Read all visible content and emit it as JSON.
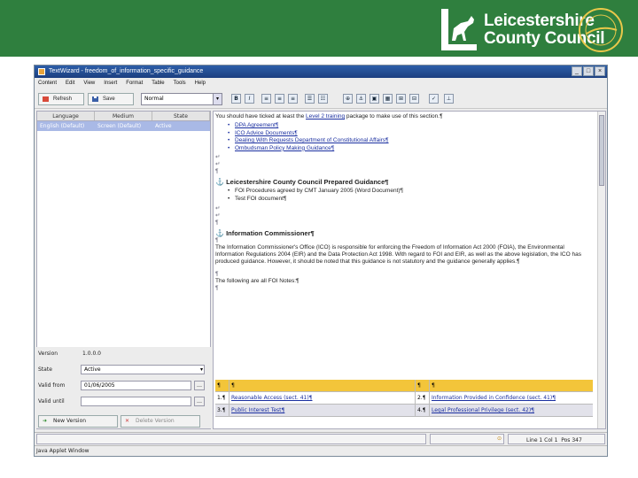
{
  "banner": {
    "council_line1": "Leicestershire",
    "council_line2": "County Council",
    "seal_text": "RATED AN Excellent COUNCIL",
    "color": "#2f7f3e"
  },
  "window": {
    "title": "TextWizard - freedom_of_information_specific_guidance",
    "menu": [
      "Content",
      "Edit",
      "View",
      "Insert",
      "Format",
      "Table",
      "Tools",
      "Help"
    ]
  },
  "toolbar": {
    "refresh_label": "Refresh",
    "save_label": "Save",
    "style_value": "Normal"
  },
  "languages": {
    "columns": [
      "Language",
      "Medium",
      "State"
    ],
    "rows": [
      [
        "English (Default)",
        "Screen (Default)",
        "Active"
      ]
    ]
  },
  "properties": {
    "version_label": "Version",
    "version_value": "1.0.0.0",
    "state_label": "State",
    "state_value": "Active",
    "valid_from_label": "Valid from",
    "valid_from_value": "01/06/2005",
    "valid_until_label": "Valid until",
    "valid_until_value": "",
    "new_version_label": "New Version",
    "delete_version_label": "Delete Version"
  },
  "document": {
    "intro": "You should have ticked at least the Level 2 training package to make use of this section.¶",
    "intro_link": "Level 2 training",
    "bullets1": [
      "DPA Agreement¶",
      "ICO Advice Documents¶",
      "Dealing With Requests Department of Constitutional Affairs¶",
      "Ombudsman Policy Making Guidance¶"
    ],
    "heading1": "Leicestershire County Council Prepared Guidance¶",
    "bullets2": [
      "FOI Procedures agreed by CMT January 2005 (Word Document)¶",
      "Test FOI document¶"
    ],
    "heading2": "Information Commissioner¶",
    "paragraph": "The Information Commissioner's Office (ICO) is responsible for enforcing the Freedom of Information Act 2000 (FOIA), the Environmental Information Regulations 2004 (EIR) and the Data Protection Act 1998. With regard to FOI and EIR, as well as the above legislation, the ICO has produced guidance. However, it should be noted that this guidance is not statutory and the guidance generally applies.¶",
    "following": "The following are all FOI Notes:¶",
    "table": {
      "header": [
        "¶",
        "¶",
        "¶",
        "¶"
      ],
      "rows": [
        [
          "1.¶",
          "Reasonable Access (sect. 41)¶",
          "2.¶",
          "Information Provided in Confidence (sect. 41)¶"
        ],
        [
          "3.¶",
          "Public Interest Test¶",
          "4.¶",
          "Legal Professional Privilege (sect. 42)¶"
        ]
      ]
    }
  },
  "status": {
    "position": "Line 1  Col 1",
    "pos": "Pos 347"
  },
  "applet_status": "Java Applet Window"
}
